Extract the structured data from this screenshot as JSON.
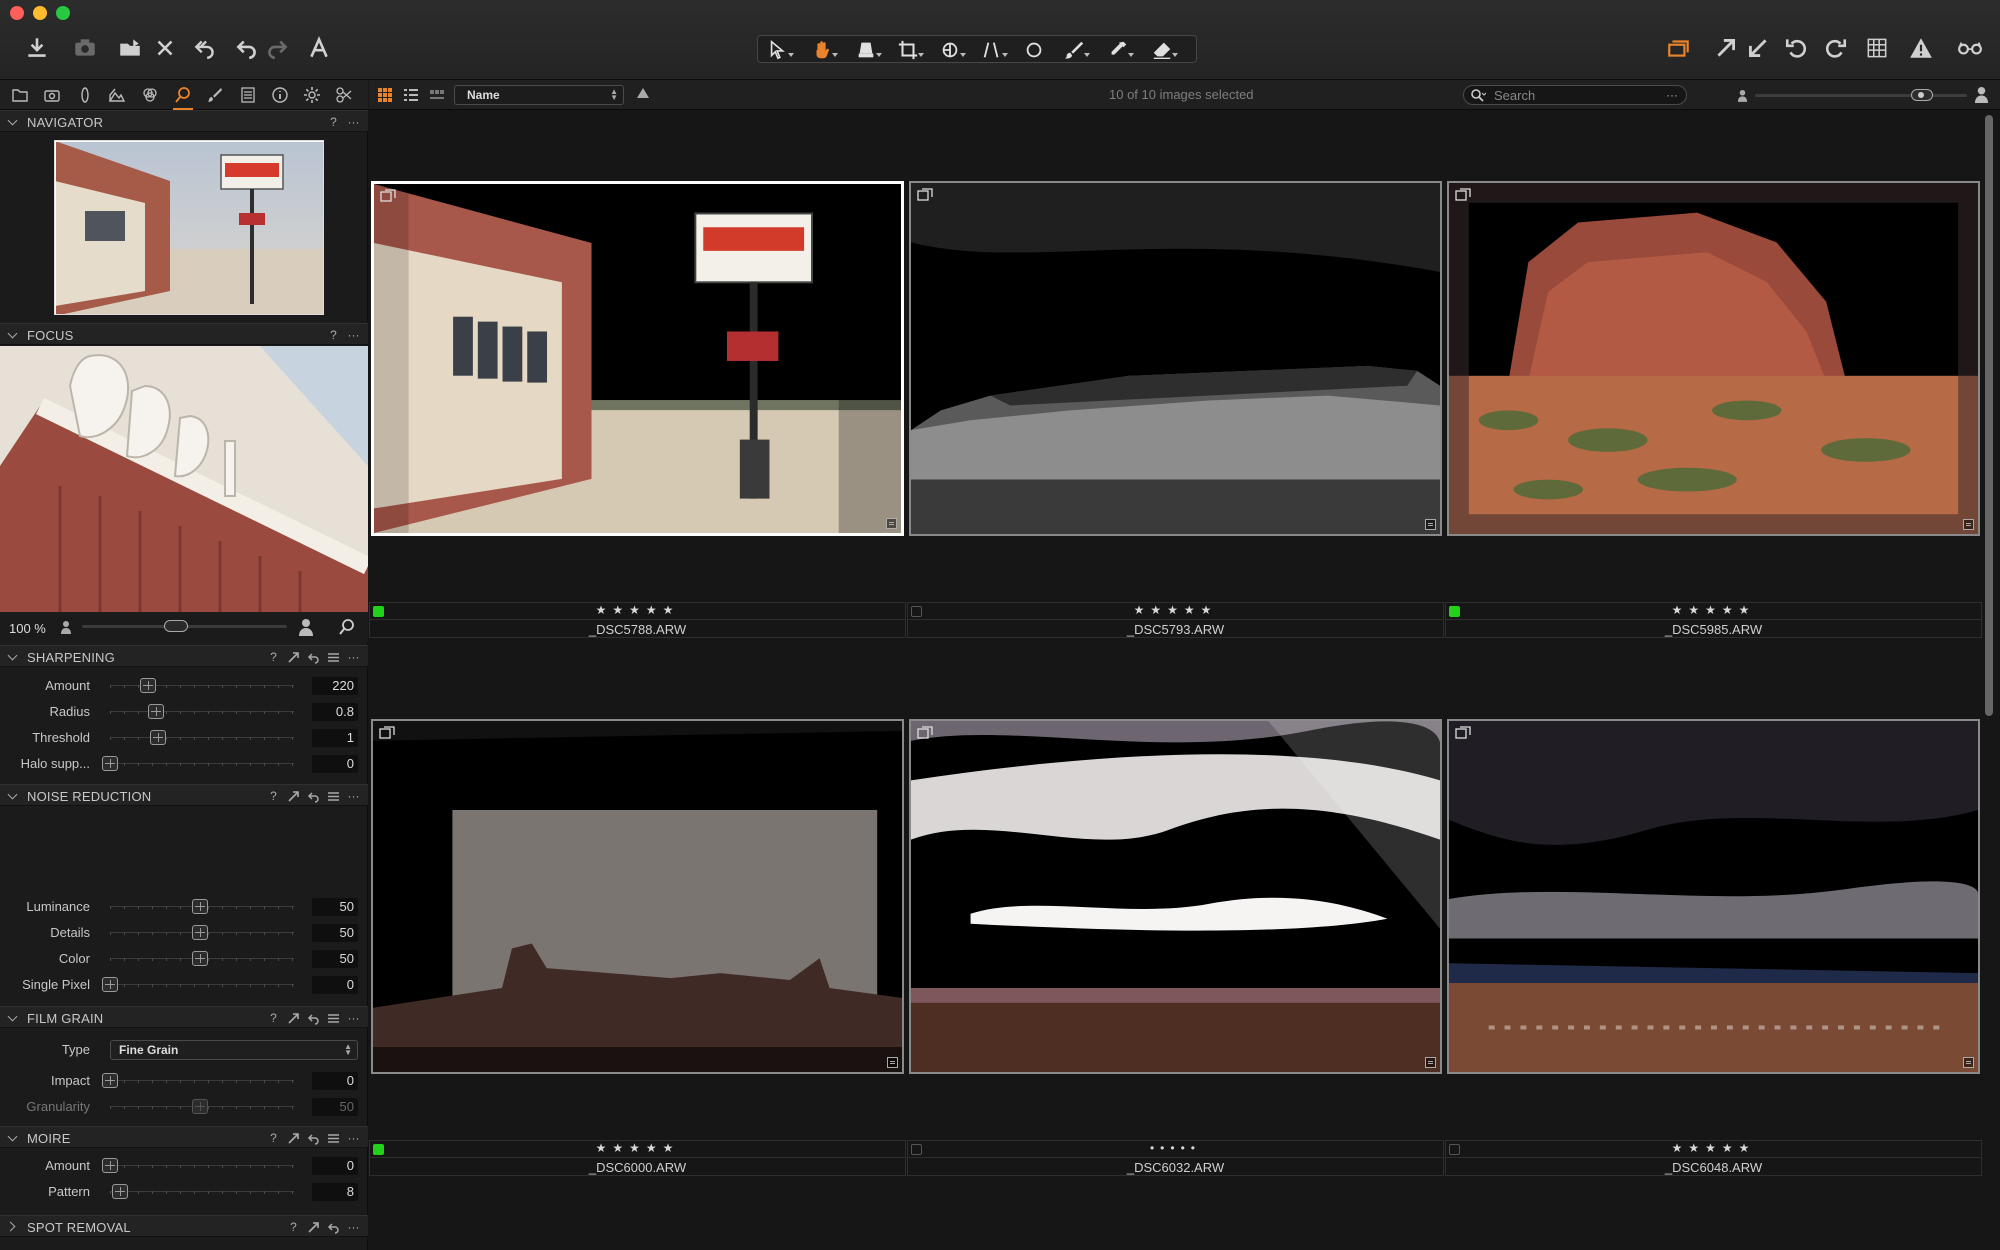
{
  "toolbar": {
    "left_icons": [
      "import-icon",
      "camera-icon",
      "open-folder-icon",
      "delete-icon",
      "undo-icon",
      "undo-icon",
      "redo-icon",
      "text-icon"
    ],
    "cursor_tools": [
      "select-pointer-icon",
      "pan-hand-icon",
      "loupe-icon",
      "crop-icon",
      "rotate-icon",
      "keystone-icon",
      "circle-mask-icon",
      "brush-icon",
      "picker-icon",
      "eraser-icon"
    ],
    "right_icons": [
      "stack-icon",
      "copy-adjustments-icon",
      "apply-adjustments-icon",
      "rotate-left-icon",
      "rotate-right-icon",
      "grid-icon",
      "exposure-warning-icon",
      "proof-glasses-icon"
    ],
    "accent": "#e9832c"
  },
  "sidebar": {
    "tabs": [
      "library-icon",
      "capture-icon",
      "lens-icon",
      "composition-icon",
      "color-icon",
      "exposure-icon",
      "details-icon",
      "local-adjustments-icon",
      "metadata-icon",
      "output-icon",
      "batch-icon",
      "styles-icon"
    ],
    "navigator": {
      "title": "NAVIGATOR"
    },
    "focus": {
      "title": "FOCUS",
      "zoom": "100 %"
    },
    "sharpening": {
      "title": "SHARPENING",
      "rows": [
        {
          "label": "Amount",
          "value": "220"
        },
        {
          "label": "Radius",
          "value": "0.8"
        },
        {
          "label": "Threshold",
          "value": "1"
        },
        {
          "label": "Halo supp...",
          "value": "0"
        }
      ]
    },
    "noise": {
      "title": "NOISE REDUCTION",
      "rows": [
        {
          "label": "Luminance",
          "value": "50"
        },
        {
          "label": "Details",
          "value": "50"
        },
        {
          "label": "Color",
          "value": "50"
        },
        {
          "label": "Single Pixel",
          "value": "0"
        }
      ]
    },
    "grain": {
      "title": "FILM GRAIN",
      "type_label": "Type",
      "type_value": "Fine Grain",
      "rows": [
        {
          "label": "Impact",
          "value": "0"
        },
        {
          "label": "Granularity",
          "value": "50"
        }
      ]
    },
    "moire": {
      "title": "MOIRE",
      "rows": [
        {
          "label": "Amount",
          "value": "0"
        },
        {
          "label": "Pattern",
          "value": "8"
        }
      ]
    },
    "spot": {
      "title": "SPOT REMOVAL"
    }
  },
  "browser": {
    "sort": "Name",
    "selected_text": "10 of 10 images selected",
    "search_placeholder": "Search",
    "images": [
      {
        "file": "_DSC5788.ARW",
        "stars": "★★★★★",
        "tag": "green",
        "selected": true
      },
      {
        "file": "_DSC5793.ARW",
        "stars": "★★★★★",
        "tag": "none",
        "selected": false
      },
      {
        "file": "_DSC5985.ARW",
        "stars": "★★★★★",
        "tag": "green",
        "selected": false
      },
      {
        "file": "_DSC6000.ARW",
        "stars": "★★★★★",
        "tag": "green",
        "selected": false
      },
      {
        "file": "_DSC6032.ARW",
        "stars": "•••••",
        "tag": "none",
        "selected": false
      },
      {
        "file": "_DSC6048.ARW",
        "stars": "★★★★★",
        "tag": "none",
        "selected": false
      }
    ],
    "tag_color": "#22d21a"
  }
}
